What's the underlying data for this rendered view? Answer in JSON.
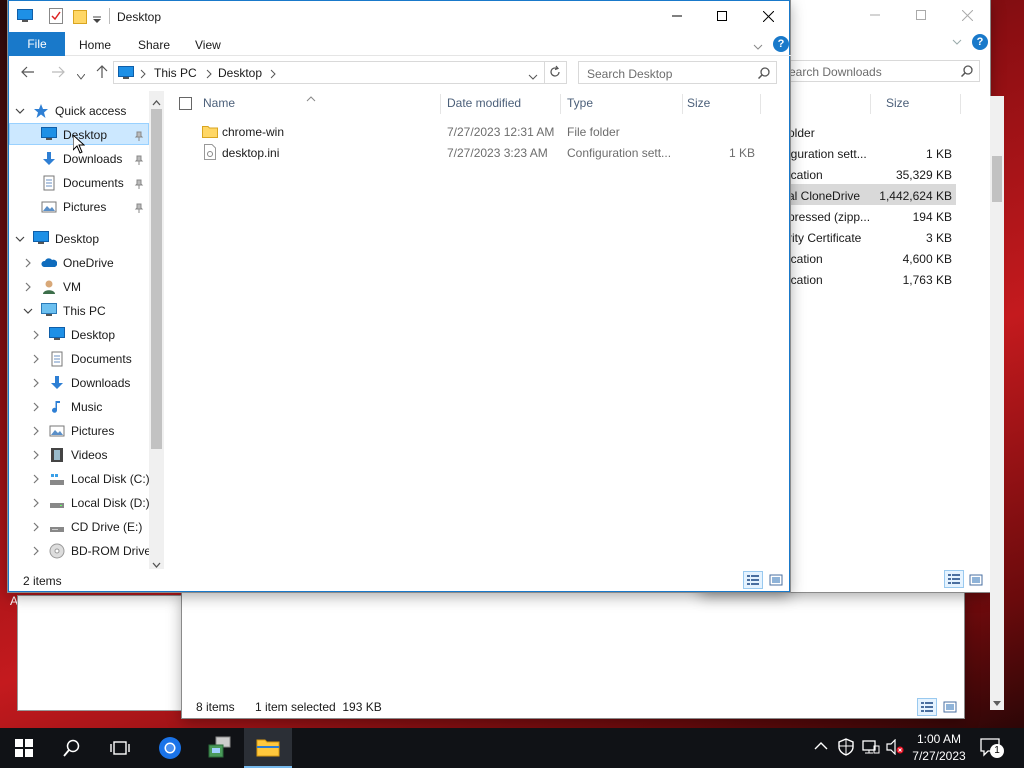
{
  "front_window": {
    "title": "Desktop",
    "ribbon_tabs": [
      "File",
      "Home",
      "Share",
      "View"
    ],
    "address": {
      "parts": [
        "This PC",
        "Desktop"
      ]
    },
    "search": {
      "placeholder": "Search Desktop"
    },
    "sidebar": {
      "quick_access": "Quick access",
      "quick_items": [
        "Desktop",
        "Downloads",
        "Documents",
        "Pictures"
      ],
      "desktop_root": "Desktop",
      "onedrive": "OneDrive",
      "vm": "VM",
      "this_pc": "This PC",
      "pc_items": [
        "Desktop",
        "Documents",
        "Downloads",
        "Music",
        "Pictures",
        "Videos",
        "Local Disk (C:)",
        "Local Disk (D:)",
        "CD Drive (E:)",
        "BD-ROM Drive"
      ]
    },
    "columns": {
      "name": "Name",
      "date": "Date modified",
      "type": "Type",
      "size": "Size"
    },
    "files": [
      {
        "name": "chrome-win",
        "date": "7/27/2023 12:31 AM",
        "type": "File folder",
        "size": ""
      },
      {
        "name": "desktop.ini",
        "date": "7/27/2023 3:23 AM",
        "type": "Configuration sett...",
        "size": "1 KB"
      }
    ],
    "status": "2 items"
  },
  "back_window": {
    "search": {
      "placeholder": "earch Downloads"
    },
    "size_header": "Size",
    "rows": [
      {
        "type": "older",
        "size": ""
      },
      {
        "type": "iguration sett...",
        "size": "1 KB"
      },
      {
        "type": "ication",
        "size": "35,329 KB"
      },
      {
        "type": "al CloneDrive",
        "size": "1,442,624 KB"
      },
      {
        "type": "pressed (zipp...",
        "size": "194 KB"
      },
      {
        "type": "rity Certificate",
        "size": "3 KB"
      },
      {
        "type": "ication",
        "size": "4,600 KB"
      },
      {
        "type": "ication",
        "size": "1,763 KB"
      }
    ]
  },
  "third_window": {
    "status_items": "8 items",
    "status_selected": "1 item selected  193 KB"
  },
  "desktop_fragment": "A",
  "taskbar": {
    "time": "1:00 AM",
    "date": "7/27/2023",
    "notification_count": "1"
  },
  "colors": {
    "accent": "#1979ca",
    "selected": "#cce8ff",
    "taskbar": "#101216"
  }
}
